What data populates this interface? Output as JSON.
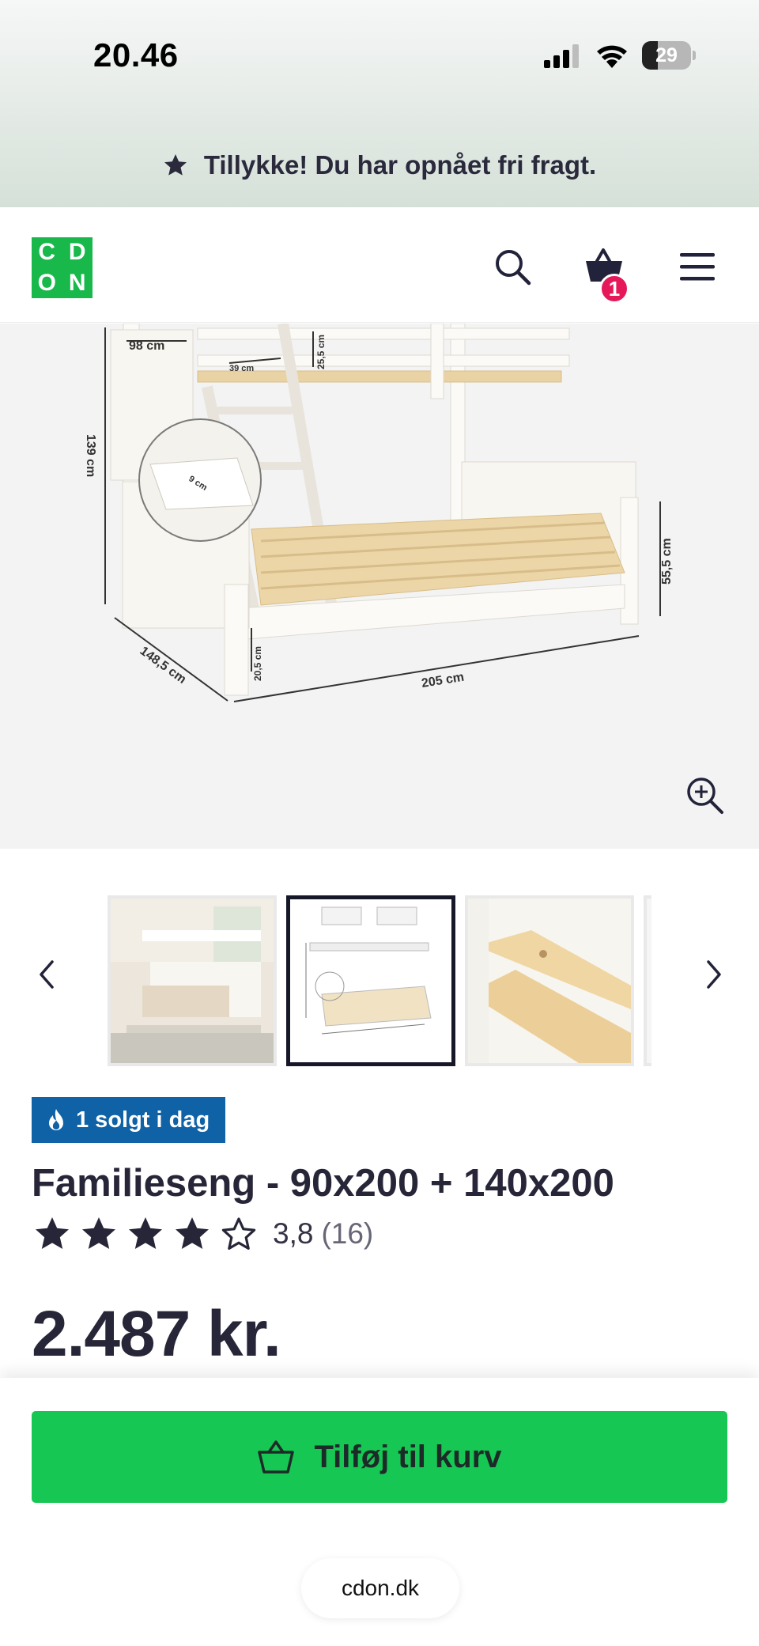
{
  "status_bar": {
    "time": "20.46",
    "battery": "29"
  },
  "promo": {
    "text": "Tillykke! Du har opnået fri fragt."
  },
  "header": {
    "logo_letters": [
      "C",
      "D",
      "O",
      "N"
    ],
    "cart_count": "1"
  },
  "hero": {
    "dimensions": [
      "98 cm",
      "39 cm",
      "25,5 cm",
      "139 cm",
      "9 cm",
      "55,5 cm",
      "20,5 cm",
      "148,5 cm",
      "205 cm"
    ]
  },
  "badge": {
    "text": "1 solgt i dag"
  },
  "product": {
    "title": "Familieseng - 90x200 + 140x200",
    "rating_value": "3,8",
    "rating_count": "(16)",
    "rating": 3.8,
    "price": "2.487 kr."
  },
  "cta": {
    "label": "Tilføj til kurv"
  },
  "browser": {
    "url": "cdon.dk"
  },
  "colors": {
    "brand_green": "#18b84b",
    "button_green": "#17c753",
    "badge_blue": "#0f62a6",
    "cart_badge": "#e5195a"
  },
  "icons": [
    "star-icon",
    "search-icon",
    "basket-icon",
    "menu-icon",
    "zoom-in-icon",
    "chevron-left-icon",
    "chevron-right-icon",
    "fire-icon"
  ]
}
